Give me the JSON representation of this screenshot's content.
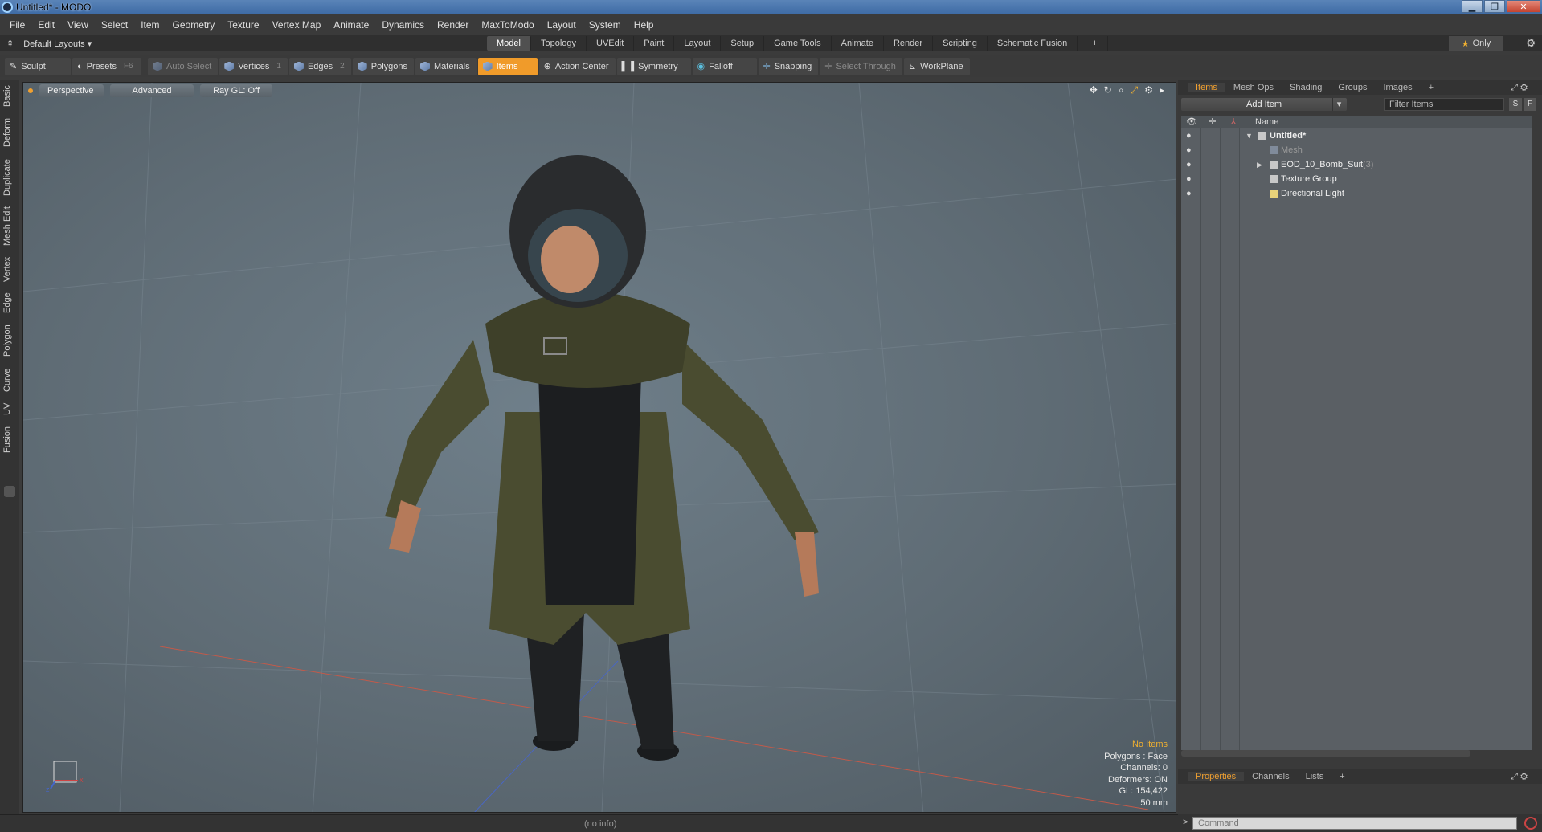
{
  "window": {
    "title": "Untitled* - MODO"
  },
  "menu": [
    "File",
    "Edit",
    "View",
    "Select",
    "Item",
    "Geometry",
    "Texture",
    "Vertex Map",
    "Animate",
    "Dynamics",
    "Render",
    "MaxToModo",
    "Layout",
    "System",
    "Help"
  ],
  "layouts": {
    "label": "Default Layouts"
  },
  "tabs": [
    "Model",
    "Topology",
    "UVEdit",
    "Paint",
    "Layout",
    "Setup",
    "Game Tools",
    "Animate",
    "Render",
    "Scripting",
    "Schematic Fusion"
  ],
  "only_label": "Only",
  "toolbar": {
    "sculpt": "Sculpt",
    "presets": "Presets",
    "presets_key": "F6",
    "auto_select": "Auto Select",
    "vertices": "Vertices",
    "vertices_key": "1",
    "edges": "Edges",
    "edges_key": "2",
    "polygons": "Polygons",
    "materials": "Materials",
    "items": "Items",
    "action_center": "Action Center",
    "symmetry": "Symmetry",
    "falloff": "Falloff",
    "snapping": "Snapping",
    "select_through": "Select Through",
    "workplane": "WorkPlane"
  },
  "left_tabs": [
    "Basic",
    "Deform",
    "Duplicate",
    "Mesh Edit",
    "Vertex",
    "Edge",
    "Polygon",
    "Curve",
    "UV",
    "Fusion"
  ],
  "viewport": {
    "view": "Perspective",
    "style": "Advanced",
    "raygl": "Ray GL: Off",
    "stats": {
      "no_items": "No Items",
      "polygons": "Polygons : Face",
      "channels": "Channels: 0",
      "deformers": "Deformers: ON",
      "gl": "GL: 154,422",
      "lens": "50 mm"
    }
  },
  "status": {
    "info": "(no info)"
  },
  "right_panel": {
    "tabs": [
      "Items",
      "Mesh Ops",
      "Shading",
      "Groups",
      "Images"
    ],
    "add_item": "Add Item",
    "filter_placeholder": "Filter Items",
    "s_btn": "S",
    "f_btn": "F",
    "name_header": "Name",
    "tree": [
      {
        "label": "Untitled*",
        "bold": true
      },
      {
        "label": "Mesh",
        "dim": true
      },
      {
        "label": "EOD_10_Bomb_Suit",
        "count": "(3)"
      },
      {
        "label": "Texture Group"
      },
      {
        "label": "Directional Light"
      }
    ],
    "bottom_tabs": [
      "Properties",
      "Channels",
      "Lists"
    ],
    "command_placeholder": "Command"
  },
  "colors": {
    "accent": "#f09b2a",
    "title_bar": "#3d6aa4",
    "viewport": "#5f6c75"
  }
}
